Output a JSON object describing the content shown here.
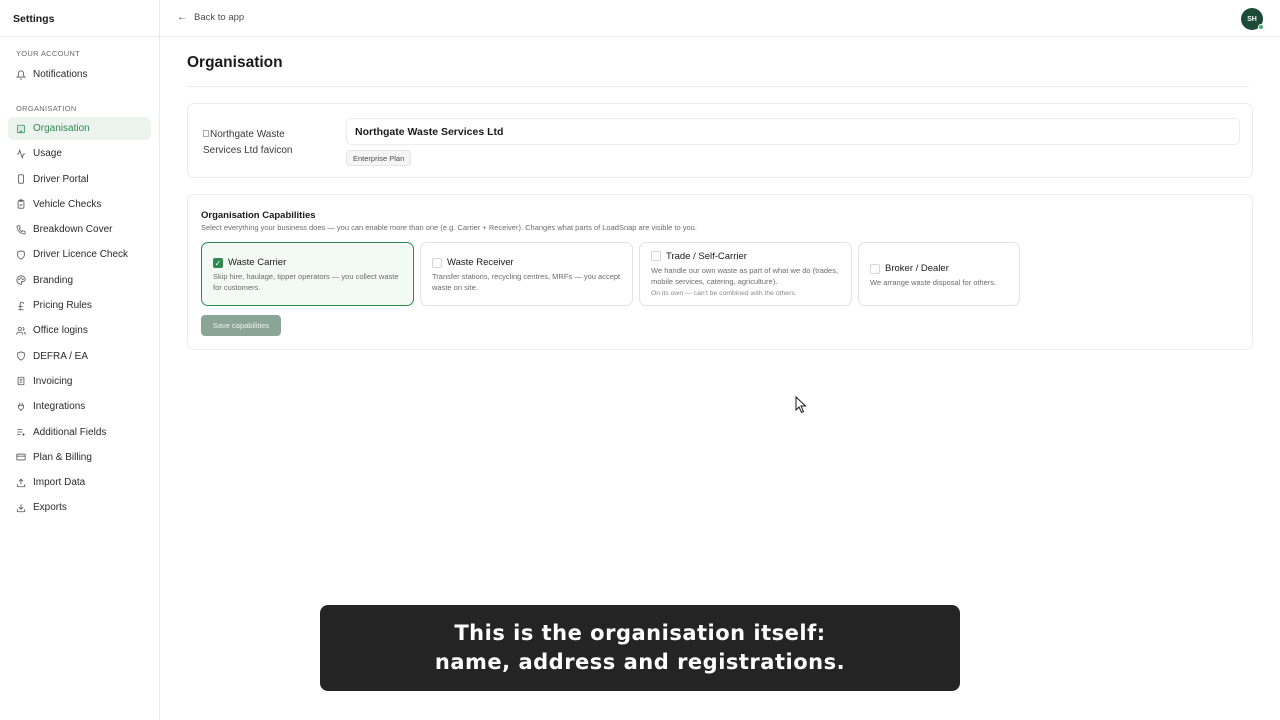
{
  "sidebar": {
    "title": "Settings",
    "sections": {
      "account_label": "YOUR ACCOUNT",
      "organisation_label": "ORGANISATION"
    },
    "account_items": [
      {
        "label": "Notifications",
        "icon": "bell-icon"
      }
    ],
    "org_items": [
      {
        "label": "Organisation",
        "icon": "building-icon",
        "active": true
      },
      {
        "label": "Usage",
        "icon": "activity-icon"
      },
      {
        "label": "Driver Portal",
        "icon": "smartphone-icon"
      },
      {
        "label": "Vehicle Checks",
        "icon": "clipboard-check-icon"
      },
      {
        "label": "Breakdown Cover",
        "icon": "phone-icon"
      },
      {
        "label": "Driver Licence Check",
        "icon": "shield-icon"
      },
      {
        "label": "Branding",
        "icon": "palette-icon"
      },
      {
        "label": "Pricing Rules",
        "icon": "pound-icon"
      },
      {
        "label": "Office logins",
        "icon": "users-icon"
      },
      {
        "label": "DEFRA / EA",
        "icon": "shield-outline-icon"
      },
      {
        "label": "Invoicing",
        "icon": "receipt-icon"
      },
      {
        "label": "Integrations",
        "icon": "plug-icon"
      },
      {
        "label": "Additional Fields",
        "icon": "list-plus-icon"
      },
      {
        "label": "Plan & Billing",
        "icon": "credit-card-icon"
      },
      {
        "label": "Import Data",
        "icon": "upload-icon"
      },
      {
        "label": "Exports",
        "icon": "download-icon"
      }
    ]
  },
  "topbar": {
    "back_label": "Back to app",
    "avatar_initials": "SH"
  },
  "main": {
    "title": "Organisation",
    "org": {
      "favicon_alt": "Northgate Waste Services Ltd favicon",
      "name_value": "Northgate Waste Services Ltd",
      "plan_badge": "Enterprise Plan"
    },
    "capabilities": {
      "title": "Organisation Capabilities",
      "subtitle": "Select everything your business does — you can enable more than one (e.g. Carrier + Receiver). Changes what parts of LoadSnap are visible to you.",
      "options": [
        {
          "label": "Waste Carrier",
          "desc": "Skip hire, haulage, tipper operators — you collect waste for customers.",
          "checked": true
        },
        {
          "label": "Waste Receiver",
          "desc": "Transfer stations, recycling centres, MRFs — you accept waste on site.",
          "checked": false
        },
        {
          "label": "Trade / Self-Carrier",
          "desc": "We handle our own waste as part of what we do (trades, mobile services, catering, agriculture).",
          "note": "On its own — can't be combined with the others.",
          "checked": false
        },
        {
          "label": "Broker / Dealer",
          "desc": "We arrange waste disposal for others.",
          "checked": false
        }
      ],
      "save_label": "Save capabilities"
    }
  },
  "caption": {
    "line1": "This is the organisation itself:",
    "line2": "name, address and registrations."
  },
  "colors": {
    "accent": "#2f8a52",
    "active_bg": "#edf4ef",
    "caption_bg": "#242424"
  }
}
